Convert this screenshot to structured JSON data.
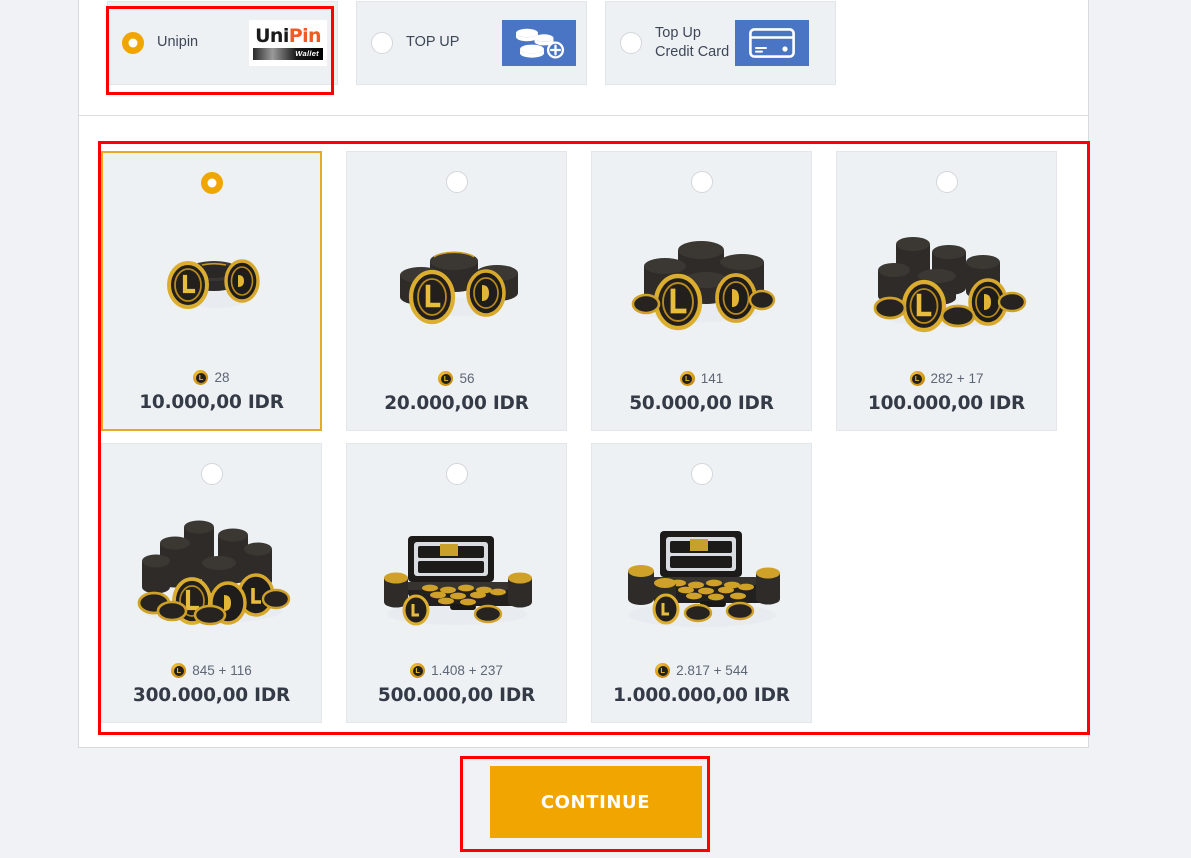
{
  "payment_methods": {
    "options": [
      {
        "label": "Unipin",
        "selected": true,
        "icon": "unipin-wallet-logo",
        "logo_text_part1": "Uni",
        "logo_text_part2": "Pin",
        "logo_subtext": "Wallet",
        "highlighted": true
      },
      {
        "label": "TOP UP",
        "selected": false,
        "icon": "coins-plus-icon",
        "highlighted": false
      },
      {
        "label": "Top Up Credit Card",
        "selected": false,
        "icon": "credit-card-icon",
        "highlighted": false
      }
    ]
  },
  "packages": {
    "items": [
      {
        "coins": "28",
        "price": "10.000,00 IDR",
        "selected": true,
        "art": "coin-stack-small"
      },
      {
        "coins": "56",
        "price": "20.000,00 IDR",
        "selected": false,
        "art": "coin-stack-medium"
      },
      {
        "coins": "141",
        "price": "50.000,00 IDR",
        "selected": false,
        "art": "coin-stack-large"
      },
      {
        "coins": "282 + 17",
        "price": "100.000,00 IDR",
        "selected": false,
        "art": "coin-pile"
      },
      {
        "coins": "845 + 116",
        "price": "300.000,00 IDR",
        "selected": false,
        "art": "coin-heap"
      },
      {
        "coins": "1.408 + 237",
        "price": "500.000,00 IDR",
        "selected": false,
        "art": "briefcase-coins"
      },
      {
        "coins": "2.817 + 544",
        "price": "1.000.000,00 IDR",
        "selected": false,
        "art": "briefcase-coins-large"
      }
    ],
    "coin_glyph": "L"
  },
  "footer": {
    "continue_label": "CONTINUE"
  },
  "colors": {
    "accent_amber": "#f0a500",
    "annotation_red": "#ff0000",
    "tile_blue": "#4a75c4",
    "card_bg": "#eef1f4",
    "page_bg": "#f1f2f6"
  }
}
